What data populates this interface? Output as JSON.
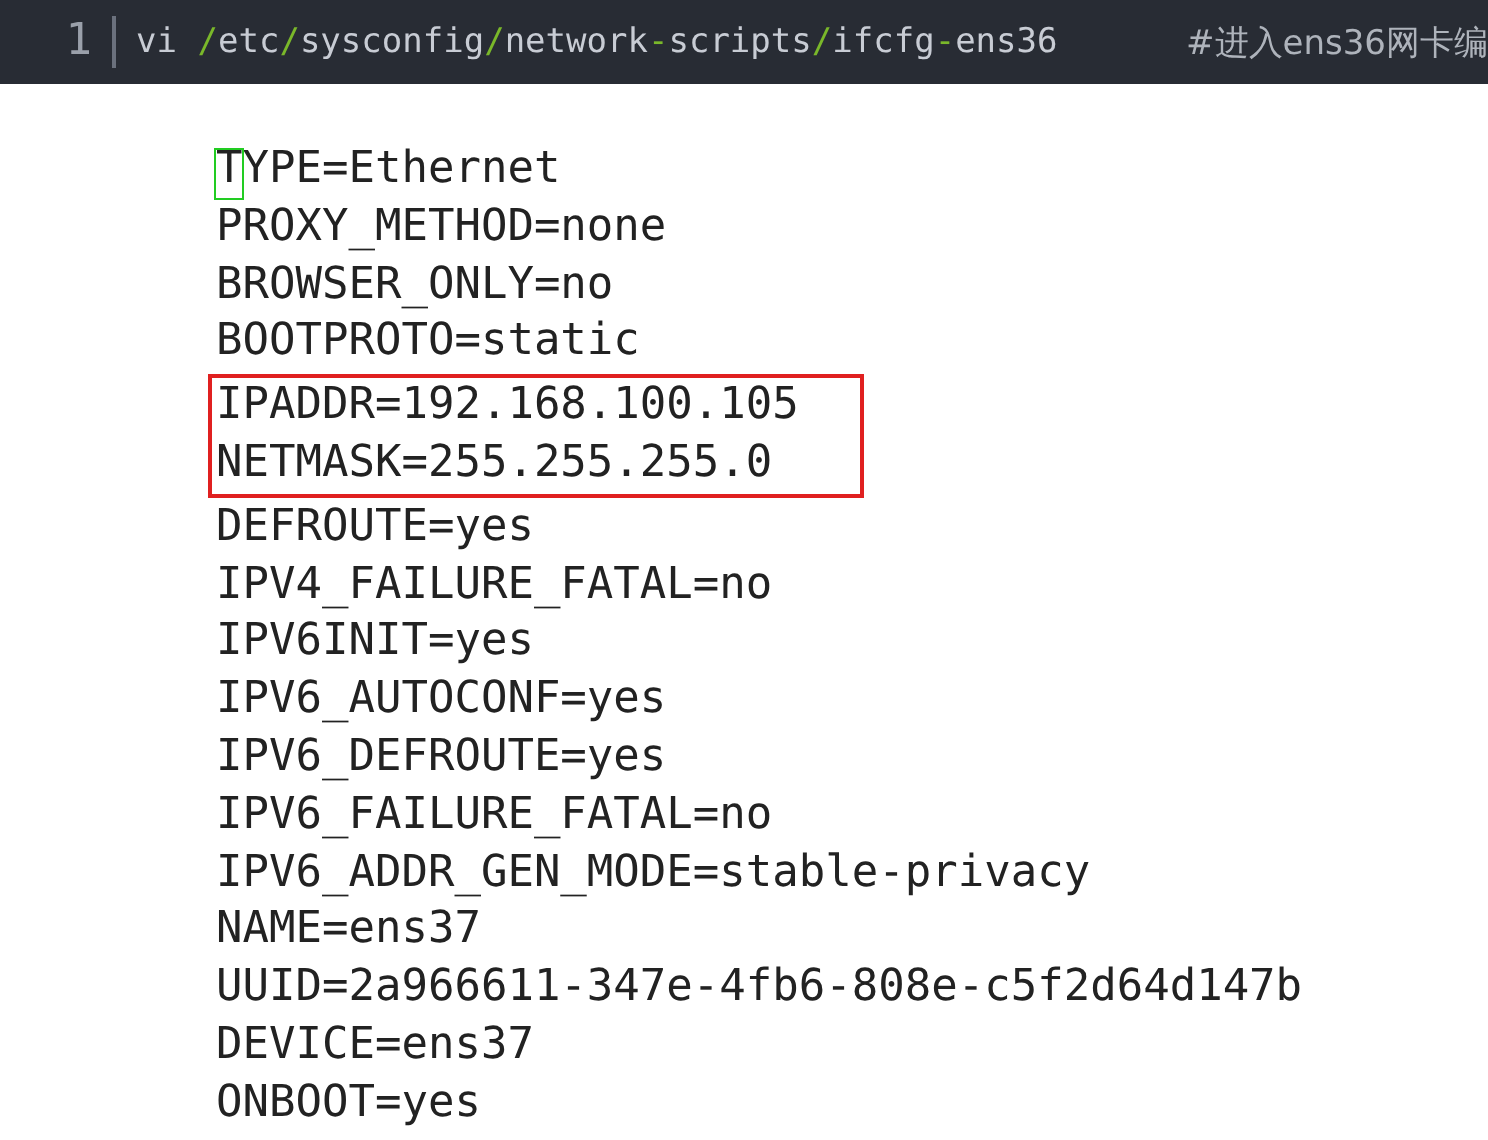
{
  "header": {
    "line_number": "1",
    "tokens": [
      {
        "text": "vi ",
        "kind": "text"
      },
      {
        "text": "/",
        "kind": "punct"
      },
      {
        "text": "etc",
        "kind": "text"
      },
      {
        "text": "/",
        "kind": "punct"
      },
      {
        "text": "sysconfig",
        "kind": "text"
      },
      {
        "text": "/",
        "kind": "punct"
      },
      {
        "text": "network",
        "kind": "text"
      },
      {
        "text": "-",
        "kind": "punct"
      },
      {
        "text": "scripts",
        "kind": "text"
      },
      {
        "text": "/",
        "kind": "punct"
      },
      {
        "text": "ifcfg",
        "kind": "text"
      },
      {
        "text": "-",
        "kind": "punct"
      },
      {
        "text": "ens36",
        "kind": "text"
      }
    ],
    "comment": "#进入ens36网卡编"
  },
  "lines": [
    {
      "text": "TYPE=Ethernet",
      "cursor": true,
      "highlight": false
    },
    {
      "text": "PROXY_METHOD=none",
      "cursor": false,
      "highlight": false
    },
    {
      "text": "BROWSER_ONLY=no",
      "cursor": false,
      "highlight": false
    },
    {
      "text": "BOOTPROTO=static",
      "cursor": false,
      "highlight": false
    },
    {
      "text": "IPADDR=192.168.100.105",
      "cursor": false,
      "highlight": true
    },
    {
      "text": "NETMASK=255.255.255.0",
      "cursor": false,
      "highlight": true
    },
    {
      "text": "DEFROUTE=yes",
      "cursor": false,
      "highlight": false
    },
    {
      "text": "IPV4_FAILURE_FATAL=no",
      "cursor": false,
      "highlight": false
    },
    {
      "text": "IPV6INIT=yes",
      "cursor": false,
      "highlight": false
    },
    {
      "text": "IPV6_AUTOCONF=yes",
      "cursor": false,
      "highlight": false
    },
    {
      "text": "IPV6_DEFROUTE=yes",
      "cursor": false,
      "highlight": false
    },
    {
      "text": "IPV6_FAILURE_FATAL=no",
      "cursor": false,
      "highlight": false
    },
    {
      "text": "IPV6_ADDR_GEN_MODE=stable-privacy",
      "cursor": false,
      "highlight": false
    },
    {
      "text": "NAME=ens37",
      "cursor": false,
      "highlight": false
    },
    {
      "text": "UUID=2a966611-347e-4fb6-808e-c5f2d64d147b",
      "cursor": false,
      "highlight": false
    },
    {
      "text": "DEVICE=ens37",
      "cursor": false,
      "highlight": false
    },
    {
      "text": "ONBOOT=yes",
      "cursor": false,
      "highlight": false
    }
  ]
}
